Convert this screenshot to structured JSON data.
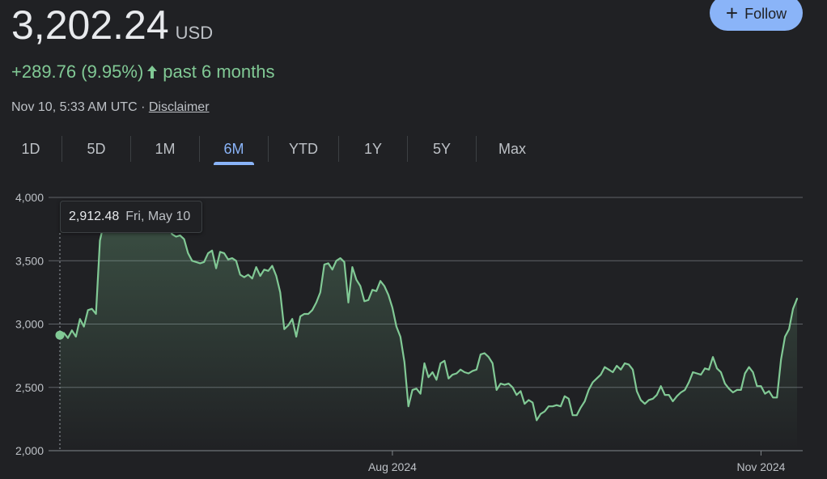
{
  "header": {
    "price": "3,202.24",
    "currency": "USD",
    "follow_label": "Follow",
    "change": "+289.76 (9.95%)",
    "change_period": "past 6 months",
    "timestamp": "Nov 10, 5:33 AM UTC · ",
    "disclaimer": "Disclaimer"
  },
  "tabs": [
    {
      "label": "1D"
    },
    {
      "label": "5D"
    },
    {
      "label": "1M"
    },
    {
      "label": "6M",
      "active": true
    },
    {
      "label": "YTD"
    },
    {
      "label": "1Y"
    },
    {
      "label": "5Y"
    },
    {
      "label": "Max"
    }
  ],
  "tooltip": {
    "value": "2,912.48",
    "date": "Fri, May 10"
  },
  "colors": {
    "line": "#81c995",
    "accent": "#8ab4f8",
    "grid": "#5f6368"
  },
  "chart_data": {
    "type": "area",
    "x_start": "2024-05-10",
    "x_end": "2024-11-10",
    "ylim": [
      2000,
      4000
    ],
    "yticks": [
      2000,
      2500,
      3000,
      3500,
      4000
    ],
    "ytick_labels": [
      "2,000",
      "2,500",
      "3,000",
      "3,500",
      "4,000"
    ],
    "xtick_labels": [
      {
        "label": "Aug 2024",
        "date": "2024-08-01"
      },
      {
        "label": "Nov 2024",
        "date": "2024-11-01"
      }
    ],
    "previous_close_marker": {
      "date": "2024-05-10",
      "value": 2912.48
    },
    "series": [
      {
        "points": [
          [
            "2024-05-10",
            2912
          ],
          [
            "2024-05-11",
            2930
          ],
          [
            "2024-05-12",
            2890
          ],
          [
            "2024-05-13",
            2950
          ],
          [
            "2024-05-14",
            2900
          ],
          [
            "2024-05-15",
            3040
          ],
          [
            "2024-05-16",
            2980
          ],
          [
            "2024-05-17",
            3110
          ],
          [
            "2024-05-18",
            3120
          ],
          [
            "2024-05-19",
            3080
          ],
          [
            "2024-05-20",
            3660
          ],
          [
            "2024-05-21",
            3800
          ],
          [
            "2024-05-22",
            3820
          ],
          [
            "2024-05-23",
            3790
          ],
          [
            "2024-05-24",
            3840
          ],
          [
            "2024-05-25",
            3810
          ],
          [
            "2024-05-26",
            3860
          ],
          [
            "2024-05-27",
            3880
          ],
          [
            "2024-05-28",
            3850
          ],
          [
            "2024-05-29",
            3800
          ],
          [
            "2024-05-30",
            3820
          ],
          [
            "2024-05-31",
            3840
          ],
          [
            "2024-06-01",
            3800
          ],
          [
            "2024-06-02",
            3820
          ],
          [
            "2024-06-03",
            3780
          ],
          [
            "2024-06-04",
            3800
          ],
          [
            "2024-06-05",
            3860
          ],
          [
            "2024-06-06",
            3800
          ],
          [
            "2024-06-07",
            3710
          ],
          [
            "2024-06-08",
            3690
          ],
          [
            "2024-06-09",
            3700
          ],
          [
            "2024-06-10",
            3670
          ],
          [
            "2024-06-11",
            3560
          ],
          [
            "2024-06-12",
            3500
          ],
          [
            "2024-06-13",
            3490
          ],
          [
            "2024-06-14",
            3480
          ],
          [
            "2024-06-15",
            3490
          ],
          [
            "2024-06-16",
            3560
          ],
          [
            "2024-06-17",
            3580
          ],
          [
            "2024-06-18",
            3440
          ],
          [
            "2024-06-19",
            3570
          ],
          [
            "2024-06-20",
            3560
          ],
          [
            "2024-06-21",
            3510
          ],
          [
            "2024-06-22",
            3520
          ],
          [
            "2024-06-23",
            3500
          ],
          [
            "2024-06-24",
            3390
          ],
          [
            "2024-06-25",
            3370
          ],
          [
            "2024-06-26",
            3390
          ],
          [
            "2024-06-27",
            3360
          ],
          [
            "2024-06-28",
            3450
          ],
          [
            "2024-06-29",
            3380
          ],
          [
            "2024-06-30",
            3430
          ],
          [
            "2024-07-01",
            3420
          ],
          [
            "2024-07-02",
            3460
          ],
          [
            "2024-07-03",
            3380
          ],
          [
            "2024-07-04",
            3250
          ],
          [
            "2024-07-05",
            2960
          ],
          [
            "2024-07-06",
            2990
          ],
          [
            "2024-07-07",
            3040
          ],
          [
            "2024-07-08",
            2900
          ],
          [
            "2024-07-09",
            3060
          ],
          [
            "2024-07-10",
            3080
          ],
          [
            "2024-07-11",
            3080
          ],
          [
            "2024-07-12",
            3110
          ],
          [
            "2024-07-13",
            3170
          ],
          [
            "2024-07-14",
            3250
          ],
          [
            "2024-07-15",
            3470
          ],
          [
            "2024-07-16",
            3480
          ],
          [
            "2024-07-17",
            3430
          ],
          [
            "2024-07-18",
            3500
          ],
          [
            "2024-07-19",
            3520
          ],
          [
            "2024-07-20",
            3490
          ],
          [
            "2024-07-21",
            3170
          ],
          [
            "2024-07-22",
            3450
          ],
          [
            "2024-07-23",
            3350
          ],
          [
            "2024-07-24",
            3300
          ],
          [
            "2024-07-25",
            3180
          ],
          [
            "2024-07-26",
            3190
          ],
          [
            "2024-07-27",
            3270
          ],
          [
            "2024-07-28",
            3260
          ],
          [
            "2024-07-29",
            3340
          ],
          [
            "2024-07-30",
            3300
          ],
          [
            "2024-07-31",
            3230
          ],
          [
            "2024-08-01",
            3130
          ],
          [
            "2024-08-02",
            2980
          ],
          [
            "2024-08-03",
            2900
          ],
          [
            "2024-08-04",
            2700
          ],
          [
            "2024-08-05",
            2350
          ],
          [
            "2024-08-06",
            2480
          ],
          [
            "2024-08-07",
            2490
          ],
          [
            "2024-08-08",
            2450
          ],
          [
            "2024-08-09",
            2690
          ],
          [
            "2024-08-10",
            2580
          ],
          [
            "2024-08-11",
            2620
          ],
          [
            "2024-08-12",
            2560
          ],
          [
            "2024-08-13",
            2690
          ],
          [
            "2024-08-14",
            2710
          ],
          [
            "2024-08-15",
            2570
          ],
          [
            "2024-08-16",
            2600
          ],
          [
            "2024-08-17",
            2610
          ],
          [
            "2024-08-18",
            2640
          ],
          [
            "2024-08-19",
            2620
          ],
          [
            "2024-08-20",
            2610
          ],
          [
            "2024-08-21",
            2630
          ],
          [
            "2024-08-22",
            2640
          ],
          [
            "2024-08-23",
            2760
          ],
          [
            "2024-08-24",
            2770
          ],
          [
            "2024-08-25",
            2740
          ],
          [
            "2024-08-26",
            2690
          ],
          [
            "2024-08-27",
            2480
          ],
          [
            "2024-08-28",
            2530
          ],
          [
            "2024-08-29",
            2520
          ],
          [
            "2024-08-30",
            2530
          ],
          [
            "2024-08-31",
            2500
          ],
          [
            "2024-09-01",
            2440
          ],
          [
            "2024-09-02",
            2470
          ],
          [
            "2024-09-03",
            2370
          ],
          [
            "2024-09-04",
            2400
          ],
          [
            "2024-09-05",
            2380
          ],
          [
            "2024-09-06",
            2240
          ],
          [
            "2024-09-07",
            2290
          ],
          [
            "2024-09-08",
            2310
          ],
          [
            "2024-09-09",
            2350
          ],
          [
            "2024-09-10",
            2350
          ],
          [
            "2024-09-11",
            2360
          ],
          [
            "2024-09-12",
            2350
          ],
          [
            "2024-09-13",
            2430
          ],
          [
            "2024-09-14",
            2410
          ],
          [
            "2024-09-15",
            2280
          ],
          [
            "2024-09-16",
            2280
          ],
          [
            "2024-09-17",
            2340
          ],
          [
            "2024-09-18",
            2390
          ],
          [
            "2024-09-19",
            2480
          ],
          [
            "2024-09-20",
            2540
          ],
          [
            "2024-09-21",
            2570
          ],
          [
            "2024-09-22",
            2600
          ],
          [
            "2024-09-23",
            2660
          ],
          [
            "2024-09-24",
            2640
          ],
          [
            "2024-09-25",
            2620
          ],
          [
            "2024-09-26",
            2670
          ],
          [
            "2024-09-27",
            2640
          ],
          [
            "2024-09-28",
            2690
          ],
          [
            "2024-09-29",
            2680
          ],
          [
            "2024-09-30",
            2640
          ],
          [
            "2024-10-01",
            2470
          ],
          [
            "2024-10-02",
            2400
          ],
          [
            "2024-10-03",
            2370
          ],
          [
            "2024-10-04",
            2400
          ],
          [
            "2024-10-05",
            2410
          ],
          [
            "2024-10-06",
            2440
          ],
          [
            "2024-10-07",
            2510
          ],
          [
            "2024-10-08",
            2440
          ],
          [
            "2024-10-09",
            2440
          ],
          [
            "2024-10-10",
            2390
          ],
          [
            "2024-10-11",
            2430
          ],
          [
            "2024-10-12",
            2460
          ],
          [
            "2024-10-13",
            2480
          ],
          [
            "2024-10-14",
            2540
          ],
          [
            "2024-10-15",
            2620
          ],
          [
            "2024-10-16",
            2610
          ],
          [
            "2024-10-17",
            2600
          ],
          [
            "2024-10-18",
            2650
          ],
          [
            "2024-10-19",
            2640
          ],
          [
            "2024-10-20",
            2740
          ],
          [
            "2024-10-21",
            2650
          ],
          [
            "2024-10-22",
            2620
          ],
          [
            "2024-10-23",
            2530
          ],
          [
            "2024-10-24",
            2490
          ],
          [
            "2024-10-25",
            2460
          ],
          [
            "2024-10-26",
            2480
          ],
          [
            "2024-10-27",
            2480
          ],
          [
            "2024-10-28",
            2610
          ],
          [
            "2024-10-29",
            2660
          ],
          [
            "2024-10-30",
            2620
          ],
          [
            "2024-10-31",
            2510
          ],
          [
            "2024-11-01",
            2510
          ],
          [
            "2024-11-02",
            2450
          ],
          [
            "2024-11-03",
            2470
          ],
          [
            "2024-11-04",
            2420
          ],
          [
            "2024-11-05",
            2420
          ],
          [
            "2024-11-06",
            2720
          ],
          [
            "2024-11-07",
            2900
          ],
          [
            "2024-11-08",
            2960
          ],
          [
            "2024-11-09",
            3120
          ],
          [
            "2024-11-10",
            3200
          ]
        ]
      }
    ]
  }
}
